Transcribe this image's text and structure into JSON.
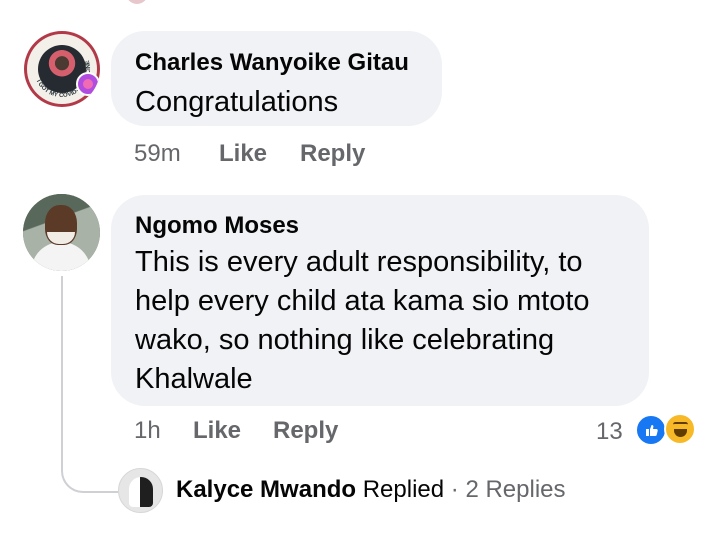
{
  "comments": [
    {
      "author": "Charles Wanyoike Gitau",
      "text": "Congratulations",
      "time": "59m",
      "like_label": "Like",
      "reply_label": "Reply",
      "avatar_text": "I GOT MY COVID-19 VACCINE"
    },
    {
      "author": "Ngomo Moses",
      "text": "This is every adult responsibility, to\nhelp every child ata kama sio mtoto\nwako, so nothing like celebrating\nKhalwale",
      "time": "1h",
      "like_label": "Like",
      "reply_label": "Reply",
      "reaction_count": "13",
      "reaction_icons": [
        "like-icon",
        "haha-icon"
      ]
    }
  ],
  "reply_summary": {
    "name": "Kalyce Mwando",
    "action": "Replied",
    "separator": "·",
    "count": "2 Replies"
  },
  "colors": {
    "bubble": "#f0f2f5",
    "secondary_text": "#65676b",
    "like_blue": "#1877f2",
    "haha_yellow": "#f7b928"
  }
}
